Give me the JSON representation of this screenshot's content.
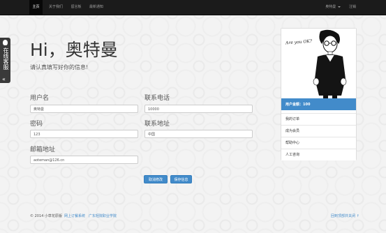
{
  "nav": {
    "left_items": [
      "主页",
      "关于我们",
      "留言板",
      "最新通知"
    ],
    "user_name": "奥特曼",
    "logout": "注销"
  },
  "side_tab": {
    "label": "在线客服",
    "arrow": "«"
  },
  "heading": {
    "title": "Hi，奥特曼",
    "subtitle": "请认真填写好你的信息!"
  },
  "form": {
    "username_label": "用户名",
    "username_value": "奥特曼",
    "phone_label": "联系电话",
    "phone_value": "10000",
    "password_label": "密码",
    "password_value": "123",
    "address_label": "联系地址",
    "address_value": "中国",
    "email_label": "邮箱地址",
    "email_value": "aoteman@126.cn",
    "cancel_label": "取消修改",
    "save_label": "保存信息"
  },
  "profile": {
    "avatar_caption": "Are you OK?",
    "points": "用户金额：100",
    "menu": [
      "我的订单",
      "成为会员",
      "帮助中心",
      "人工咨询"
    ]
  },
  "footer": {
    "copyright": "© 2014 小草花原版",
    "link1": "网上订餐系统",
    "link2": "广东轻院职业学院",
    "back_top": "回到顶部并关闭 ↑"
  },
  "colors": {
    "nav_bg": "#1b1b1b",
    "accent": "#428bca"
  }
}
